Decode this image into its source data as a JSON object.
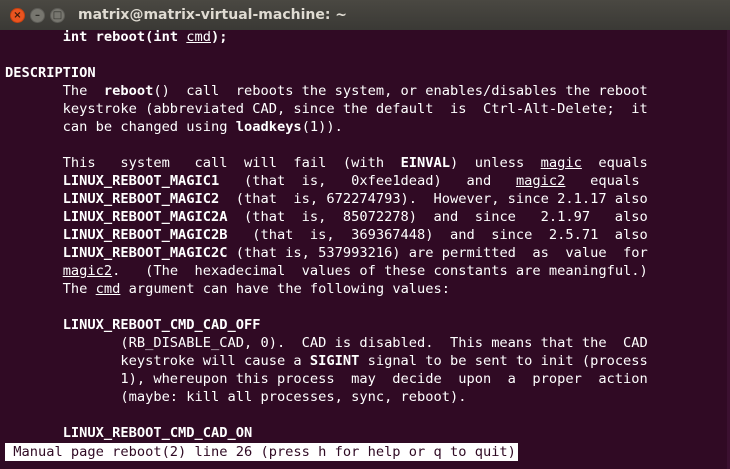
{
  "window": {
    "title": "matrix@matrix-virtual-machine: ~",
    "close_glyph": "×",
    "minimize_glyph": "–",
    "maximize_glyph": "□"
  },
  "manpage": {
    "synopsis_line": [
      {
        "t": "       "
      },
      {
        "t": "int reboot(int ",
        "b": true
      },
      {
        "t": "cmd",
        "u": true
      },
      {
        "t": ");",
        "b": true
      }
    ],
    "section_heading": "DESCRIPTION",
    "lines": [
      [
        {
          "t": "       The  "
        },
        {
          "t": "reboot",
          "b": true
        },
        {
          "t": "()  call  reboots the system, or enables/disables the reboot"
        }
      ],
      [
        {
          "t": "       keystroke (abbreviated CAD, since the default  is  Ctrl-Alt-Delete;  it"
        }
      ],
      [
        {
          "t": "       can be changed using "
        },
        {
          "t": "loadkeys",
          "b": true
        },
        {
          "t": "(1))."
        }
      ],
      [
        {
          "t": ""
        }
      ],
      [
        {
          "t": "       This   system   call  will  fail  (with  "
        },
        {
          "t": "EINVAL",
          "b": true
        },
        {
          "t": ")  unless  "
        },
        {
          "t": "magic",
          "u": true
        },
        {
          "t": "  equals"
        }
      ],
      [
        {
          "t": "       "
        },
        {
          "t": "LINUX_REBOOT_MAGIC1",
          "b": true
        },
        {
          "t": "   (that  is,   0xfee1dead)   and   "
        },
        {
          "t": "magic2",
          "u": true
        },
        {
          "t": "   equals"
        }
      ],
      [
        {
          "t": "       "
        },
        {
          "t": "LINUX_REBOOT_MAGIC2",
          "b": true
        },
        {
          "t": "  (that  is, 672274793).  However, since 2.1.17 also"
        }
      ],
      [
        {
          "t": "       "
        },
        {
          "t": "LINUX_REBOOT_MAGIC2A",
          "b": true
        },
        {
          "t": "  (that  is,  85072278)  and  since   2.1.97   also"
        }
      ],
      [
        {
          "t": "       "
        },
        {
          "t": "LINUX_REBOOT_MAGIC2B",
          "b": true
        },
        {
          "t": "   (that  is,  369367448)  and  since  2.5.71  also"
        }
      ],
      [
        {
          "t": "       "
        },
        {
          "t": "LINUX_REBOOT_MAGIC2C",
          "b": true
        },
        {
          "t": " (that is, 537993216) are permitted  as  value  for"
        }
      ],
      [
        {
          "t": "       "
        },
        {
          "t": "magic2",
          "u": true
        },
        {
          "t": ".   (The  hexadecimal  values of these constants are meaningful.)"
        }
      ],
      [
        {
          "t": "       The "
        },
        {
          "t": "cmd",
          "u": true
        },
        {
          "t": " argument can have the following values:"
        }
      ],
      [
        {
          "t": ""
        }
      ],
      [
        {
          "t": "       "
        },
        {
          "t": "LINUX_REBOOT_CMD_CAD_OFF",
          "b": true
        }
      ],
      [
        {
          "t": "              (RB_DISABLE_CAD, 0).  CAD is disabled.  This means that the  CAD"
        }
      ],
      [
        {
          "t": "              keystroke will cause a "
        },
        {
          "t": "SIGINT",
          "b": true
        },
        {
          "t": " signal to be sent to init (process"
        }
      ],
      [
        {
          "t": "              1), whereupon this process  may  decide  upon  a  proper  action"
        }
      ],
      [
        {
          "t": "              (maybe: kill all processes, sync, reboot)."
        }
      ],
      [
        {
          "t": ""
        }
      ],
      [
        {
          "t": "       "
        },
        {
          "t": "LINUX_REBOOT_CMD_CAD_ON",
          "b": true
        }
      ]
    ],
    "status_line": " Manual page reboot(2) line 26 (press h for help or q to quit)"
  }
}
